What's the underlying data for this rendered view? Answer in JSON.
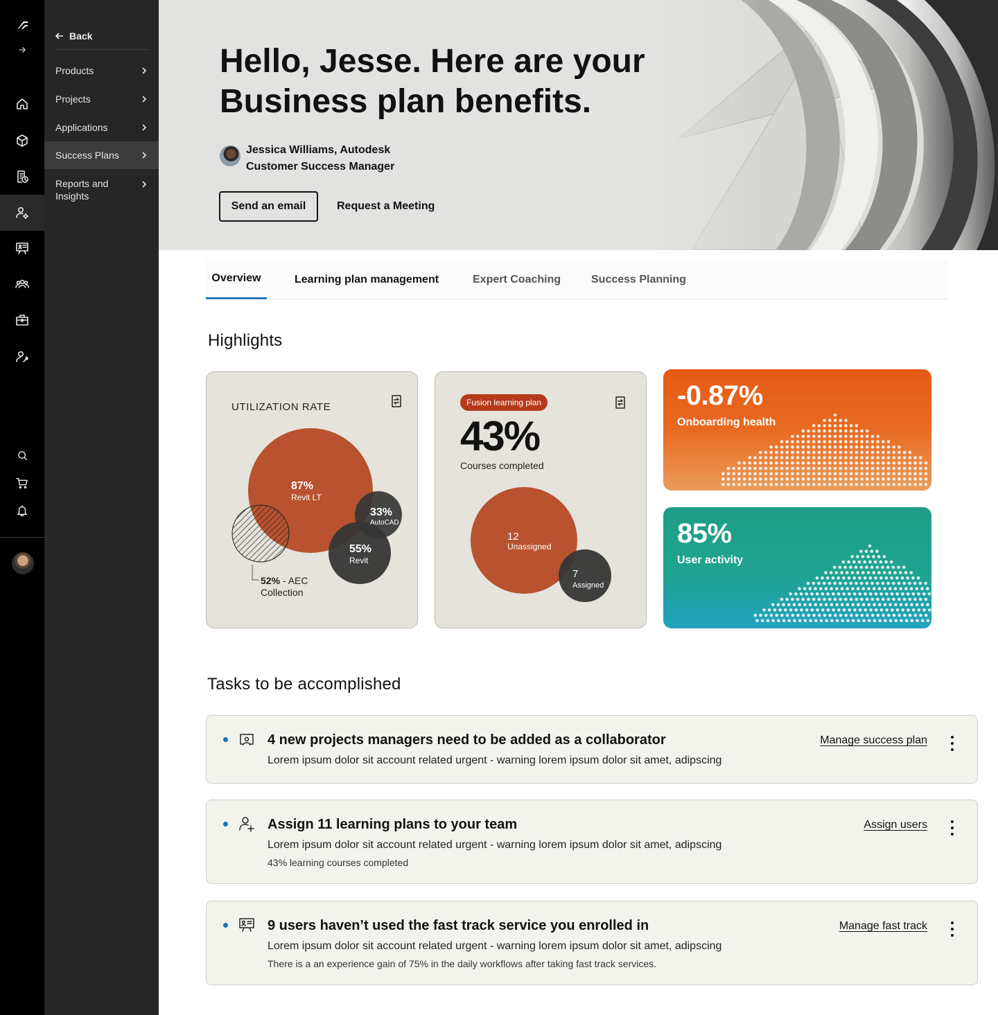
{
  "rail": {
    "icons": [
      "autodesk-logo-icon",
      "expand-arrow-icon",
      "home-icon",
      "cube-icon",
      "document-clock-icon",
      "user-gear-icon",
      "presentation-icon",
      "team-icon",
      "briefcase-icon",
      "user-wrench-icon",
      "search-icon",
      "cart-icon",
      "bell-icon"
    ],
    "active_icon": "user-gear-icon"
  },
  "panel": {
    "back_label": "Back",
    "items": [
      {
        "label": "Products"
      },
      {
        "label": "Projects"
      },
      {
        "label": "Applications"
      },
      {
        "label": "Success Plans",
        "selected": true
      },
      {
        "label": "Reports and Insights"
      }
    ]
  },
  "hero": {
    "title_line1": "Hello, Jesse. Here are your",
    "title_line2": "Business plan benefits.",
    "contact_name": "Jessica Williams, Autodesk",
    "contact_role": "Customer Success Manager",
    "email_button": "Send an email",
    "meeting_button": "Request a Meeting"
  },
  "tabs": [
    {
      "label": "Overview",
      "active": true
    },
    {
      "label": "Learning plan management"
    },
    {
      "label": "Expert Coaching"
    },
    {
      "label": "Success Planning"
    }
  ],
  "highlights": {
    "heading": "Highlights",
    "utilization": {
      "label": "UTILIZATION RATE",
      "bubbles": [
        {
          "value": "87%",
          "name": "Revit LT"
        },
        {
          "value": "33%",
          "name": "AutoCAD"
        },
        {
          "value": "55%",
          "name": "Revit"
        }
      ],
      "aec_value": "52%",
      "aec_label_1": " - AEC",
      "aec_label_2": "Collection"
    },
    "learning": {
      "pill": "Fusion learning plan",
      "percent": "43%",
      "caption": "Courses completed",
      "unassigned_value": "12",
      "unassigned_label": "Unassigned",
      "assigned_value": "7",
      "assigned_label": "Assigned"
    },
    "onboarding": {
      "value": "-0.87%",
      "label": "Onboarding health",
      "color": "#e65a14"
    },
    "activity": {
      "value": "85%",
      "label": "User activity",
      "color": "#1fa391"
    }
  },
  "tasks": {
    "heading": "Tasks to be accomplished",
    "items": [
      {
        "icon": "presenter-icon",
        "title": "4 new projects managers need to be added as a collaborator",
        "description": "Lorem ipsum dolor sit account related urgent - warning lorem ipsum dolor sit amet, adipscing",
        "meta": "",
        "action": "Manage success plan"
      },
      {
        "icon": "add-user-icon",
        "title": "Assign 11 learning plans to your team",
        "description": "Lorem ipsum dolor sit account related urgent - warning lorem ipsum dolor sit amet, adipscing",
        "meta": "43% learning courses completed",
        "action": "Assign users"
      },
      {
        "icon": "presentation-board-icon",
        "title": "9 users haven’t used the fast track service you enrolled in",
        "description": "Lorem ipsum dolor sit account related urgent - warning lorem ipsum dolor sit amet, adipscing",
        "meta": "There is a an experience gain of 75% in the daily workflows after taking fast track services.",
        "action": "Manage fast track"
      }
    ]
  },
  "colors": {
    "accent": "#2b74b8",
    "bubble_rust": "#b9522f",
    "bubble_dark": "#363636",
    "pill": "#b5391a"
  }
}
